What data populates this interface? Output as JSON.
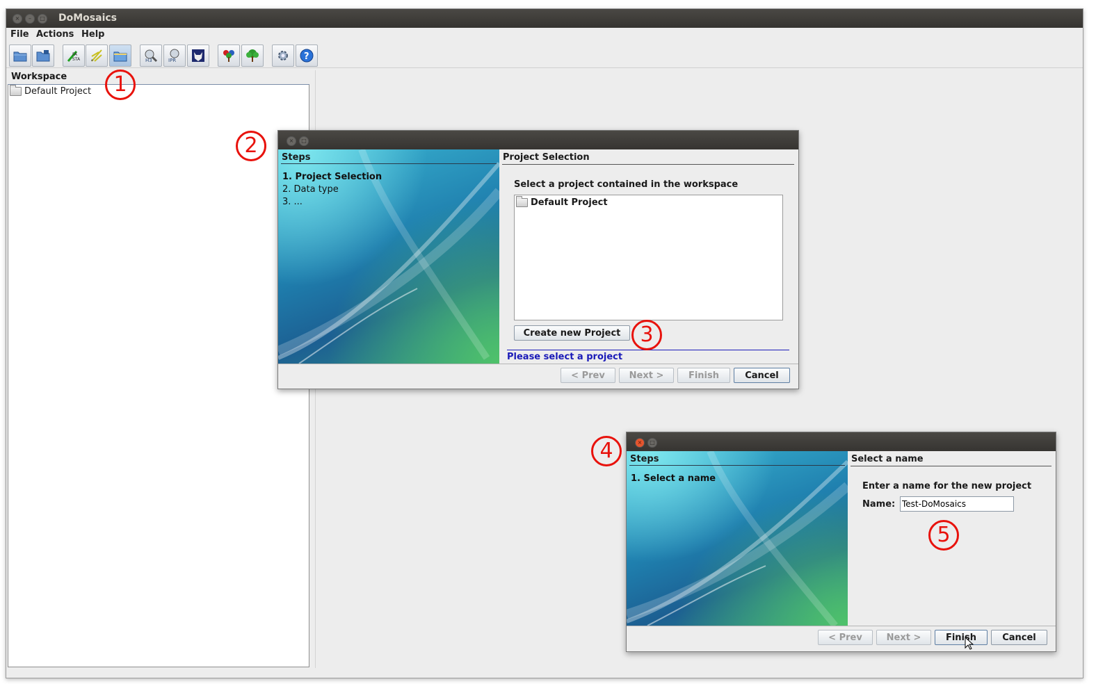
{
  "window": {
    "title": "DoMosaics"
  },
  "menu": [
    "File",
    "Actions",
    "Help"
  ],
  "toolbar": {
    "buttons": [
      "open-folder-icon",
      "save-icon",
      "import-fasta-icon",
      "import-annotation-icon",
      "project-folder-icon",
      "hmmscan-icon",
      "interproscan-icon",
      "wolf-icon",
      "domain-tree-icon",
      "tree-icon",
      "settings-gear-icon",
      "help-icon"
    ]
  },
  "workspace": {
    "title": "Workspace",
    "items": [
      "Default Project"
    ]
  },
  "dialog1": {
    "steps_title": "Steps",
    "steps": [
      "1. Project Selection",
      "2. Data type",
      "3. ..."
    ],
    "pane_title": "Project Selection",
    "prompt": "Select a project contained in the workspace",
    "projects": [
      "Default Project"
    ],
    "create_button": "Create new Project",
    "status": "Please select a project",
    "buttons": {
      "prev": "< Prev",
      "next": "Next >",
      "finish": "Finish",
      "cancel": "Cancel"
    }
  },
  "dialog2": {
    "steps_title": "Steps",
    "steps": [
      "1. Select a name"
    ],
    "pane_title": "Select a name",
    "prompt": "Enter a name for the new project",
    "name_label": "Name:",
    "name_value": "Test-DoMosaics",
    "buttons": {
      "prev": "< Prev",
      "next": "Next >",
      "finish": "Finish",
      "cancel": "Cancel"
    }
  },
  "callouts": [
    "1",
    "2",
    "3",
    "4",
    "5"
  ],
  "colors": {
    "callout": "#e8120c",
    "status_text": "#1a1ab8",
    "titlebar": "#3c3b37"
  }
}
